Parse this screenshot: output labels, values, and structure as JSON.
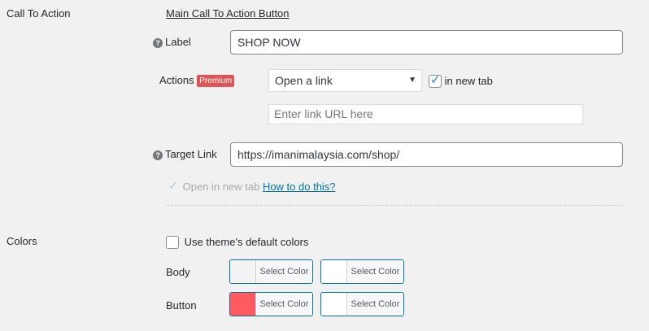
{
  "cta": {
    "section_label": "Call To Action",
    "sub_heading": "Main Call To Action Button",
    "label_field": {
      "label": "Label",
      "value": "SHOP NOW"
    },
    "actions": {
      "label": "Actions",
      "badge": "Premium",
      "select_value": "Open a link",
      "new_tab_label": "in new tab",
      "new_tab_checked": true,
      "url_placeholder": "Enter link URL here"
    },
    "target_link": {
      "label": "Target Link",
      "value": "https://imanimalaysia.com/shop/"
    },
    "open_new_tab": {
      "label": "Open in new tab",
      "checked": true,
      "help_link": "How to do this?"
    }
  },
  "colors": {
    "section_label": "Colors",
    "use_default_label": "Use theme's default colors",
    "use_default_checked": false,
    "rows": [
      {
        "label": "Body",
        "pickers": [
          {
            "text": "Select Color",
            "color": "#f3f3f3"
          },
          {
            "text": "Select Color",
            "color": "#ffffff"
          }
        ]
      },
      {
        "label": "Button",
        "pickers": [
          {
            "text": "Select Color",
            "color": "#ff5a5f"
          },
          {
            "text": "Select Color",
            "color": "#ffffff"
          }
        ]
      }
    ]
  }
}
